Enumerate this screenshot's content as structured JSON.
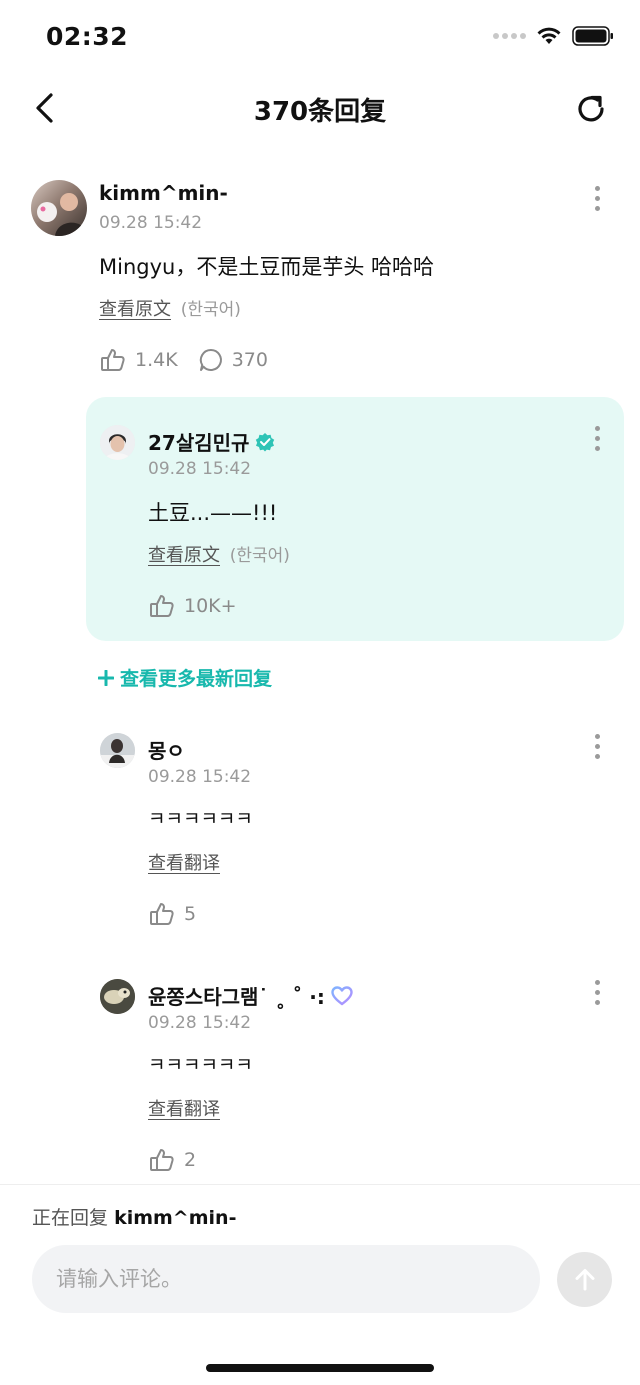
{
  "status": {
    "time": "02:32"
  },
  "nav": {
    "title": "370条回复"
  },
  "main_comment": {
    "username": "kimm^min-",
    "timestamp": "09.28 15:42",
    "text": "Mingyu，不是土豆而是芋头 哈哈哈",
    "view_original": "查看原文",
    "lang": "(한국어)",
    "likes": "1.4K",
    "replies": "370"
  },
  "highlight_reply": {
    "username": "27살김민규",
    "timestamp": "09.28 15:42",
    "text": "土豆...——!!!",
    "view_original": "查看原文",
    "lang": "(한국어)",
    "likes": "10K+"
  },
  "see_more": {
    "label": "查看更多最新回复"
  },
  "replies": [
    {
      "username": "몽ㅇ",
      "timestamp": "09.28 15:42",
      "text": "ㅋㅋㅋㅋㅋㅋ",
      "translate": "查看翻译",
      "likes": "5"
    },
    {
      "username": "윤쫑스타그램˙ ˳ ˚ ·:",
      "timestamp": "09.28 15:42",
      "text": "ㅋㅋㅋㅋㅋㅋ",
      "translate": "查看翻译",
      "likes": "2"
    }
  ],
  "composer": {
    "replying_prefix": "正在回复",
    "replying_to": "kimm^min-",
    "placeholder": "请输入评论。"
  },
  "colors": {
    "accent": "#18b8ad",
    "highlight_bg": "#e5f9f5",
    "verified": "#2ec4b6"
  }
}
